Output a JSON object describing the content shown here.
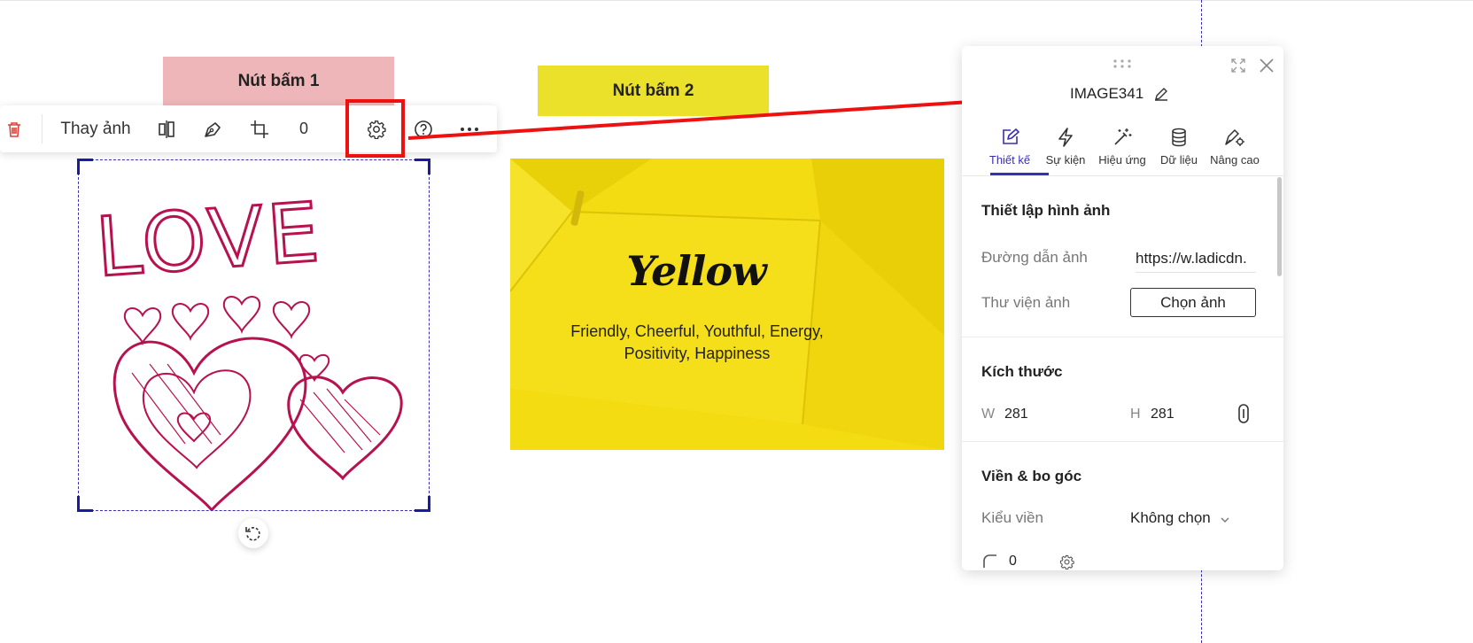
{
  "canvas": {
    "button1_label": "Nút bấm 1",
    "button2_label": "Nút bấm 2"
  },
  "toolbar": {
    "replace_image_label": "Thay ảnh",
    "rotation_value": "0",
    "icons": [
      "trash-icon",
      "flip-icon",
      "pen-icon",
      "crop-icon",
      "gear-icon",
      "help-icon",
      "more-icon"
    ]
  },
  "image_love": {
    "text": "LOVE"
  },
  "image_yellow": {
    "title": "Yellow",
    "subtitle_line1": "Friendly, Cheerful, Youthful, Energy,",
    "subtitle_line2": "Positivity, Happiness"
  },
  "panel": {
    "element_name": "IMAGE341",
    "tabs": [
      {
        "label": "Thiết kế",
        "icon": "edit-icon",
        "active": true
      },
      {
        "label": "Sự kiện",
        "icon": "lightning-icon",
        "active": false
      },
      {
        "label": "Hiệu ứng",
        "icon": "magic-wand-icon",
        "active": false
      },
      {
        "label": "Dữ liệu",
        "icon": "database-icon",
        "active": false
      },
      {
        "label": "Nâng cao",
        "icon": "advanced-icon",
        "active": false
      }
    ],
    "image_settings": {
      "title": "Thiết lập hình ảnh",
      "url_label": "Đường dẫn ảnh",
      "url_value": "https://w.ladicdn.",
      "library_label": "Thư viện ảnh",
      "choose_button": "Chọn ảnh"
    },
    "size": {
      "title": "Kích thước",
      "w_label": "W",
      "w_value": "281",
      "h_label": "H",
      "h_value": "281"
    },
    "border": {
      "title": "Viền & bo góc",
      "style_label": "Kiểu viền",
      "style_value": "Không chọn",
      "radius_value": "0"
    }
  },
  "colors": {
    "accent": "#3a2fb0",
    "highlight": "#ee1111",
    "button1_bg": "#eeb6b8",
    "button2_bg": "#ebe02a",
    "love_ink": "#b7124f",
    "delete": "#e0413a"
  }
}
